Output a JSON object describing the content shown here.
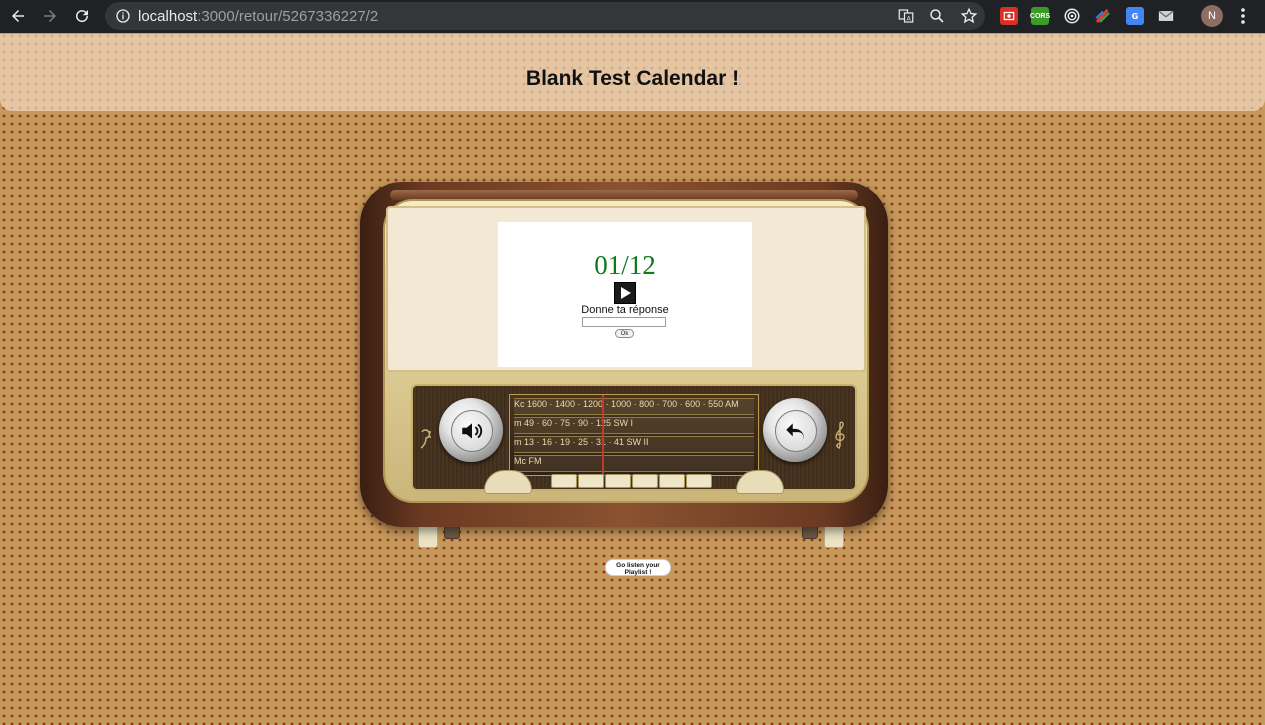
{
  "browser": {
    "url_host": "localhost",
    "url_path": ":3000/retour/5267336227/2",
    "profile_initial": "N",
    "extensions": [
      "translate-icon",
      "zoom-icon",
      "bookmark-star-icon",
      "extension-red-icon",
      "cors-extension-icon",
      "target-extension-icon",
      "color-picker-extension-icon",
      "google-translate-extension-icon",
      "mail-extension-icon"
    ],
    "cors_label": "CORS"
  },
  "header": {
    "title": "Blank Test Calendar !"
  },
  "radio": {
    "day_counter": "01/12",
    "prompt": "Donne ta réponse",
    "answer_value": "",
    "ok_label": "Ok",
    "dial_rows": [
      "Kc  1600 · 1400 · 1200 · 1000 · 800 · 700 · 600 · 550  AM",
      "m      49   ·   60   ·   75   ·   90   ·  125     SW I",
      "m    13   ·   16   ·   19   ·   25   ·   31   ·   41  SW II",
      "Mc                                                        FM"
    ],
    "colors": {
      "day_counter": "#0f7a1a"
    }
  },
  "playlist_button": {
    "label": "Go listen your\nPlaylist !"
  }
}
